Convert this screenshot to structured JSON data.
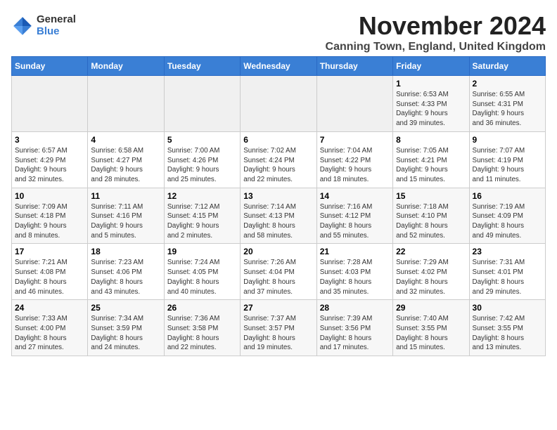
{
  "logo": {
    "general": "General",
    "blue": "Blue"
  },
  "title": "November 2024",
  "location": "Canning Town, England, United Kingdom",
  "headers": [
    "Sunday",
    "Monday",
    "Tuesday",
    "Wednesday",
    "Thursday",
    "Friday",
    "Saturday"
  ],
  "weeks": [
    [
      {
        "day": "",
        "info": ""
      },
      {
        "day": "",
        "info": ""
      },
      {
        "day": "",
        "info": ""
      },
      {
        "day": "",
        "info": ""
      },
      {
        "day": "",
        "info": ""
      },
      {
        "day": "1",
        "info": "Sunrise: 6:53 AM\nSunset: 4:33 PM\nDaylight: 9 hours\nand 39 minutes."
      },
      {
        "day": "2",
        "info": "Sunrise: 6:55 AM\nSunset: 4:31 PM\nDaylight: 9 hours\nand 36 minutes."
      }
    ],
    [
      {
        "day": "3",
        "info": "Sunrise: 6:57 AM\nSunset: 4:29 PM\nDaylight: 9 hours\nand 32 minutes."
      },
      {
        "day": "4",
        "info": "Sunrise: 6:58 AM\nSunset: 4:27 PM\nDaylight: 9 hours\nand 28 minutes."
      },
      {
        "day": "5",
        "info": "Sunrise: 7:00 AM\nSunset: 4:26 PM\nDaylight: 9 hours\nand 25 minutes."
      },
      {
        "day": "6",
        "info": "Sunrise: 7:02 AM\nSunset: 4:24 PM\nDaylight: 9 hours\nand 22 minutes."
      },
      {
        "day": "7",
        "info": "Sunrise: 7:04 AM\nSunset: 4:22 PM\nDaylight: 9 hours\nand 18 minutes."
      },
      {
        "day": "8",
        "info": "Sunrise: 7:05 AM\nSunset: 4:21 PM\nDaylight: 9 hours\nand 15 minutes."
      },
      {
        "day": "9",
        "info": "Sunrise: 7:07 AM\nSunset: 4:19 PM\nDaylight: 9 hours\nand 11 minutes."
      }
    ],
    [
      {
        "day": "10",
        "info": "Sunrise: 7:09 AM\nSunset: 4:18 PM\nDaylight: 9 hours\nand 8 minutes."
      },
      {
        "day": "11",
        "info": "Sunrise: 7:11 AM\nSunset: 4:16 PM\nDaylight: 9 hours\nand 5 minutes."
      },
      {
        "day": "12",
        "info": "Sunrise: 7:12 AM\nSunset: 4:15 PM\nDaylight: 9 hours\nand 2 minutes."
      },
      {
        "day": "13",
        "info": "Sunrise: 7:14 AM\nSunset: 4:13 PM\nDaylight: 8 hours\nand 58 minutes."
      },
      {
        "day": "14",
        "info": "Sunrise: 7:16 AM\nSunset: 4:12 PM\nDaylight: 8 hours\nand 55 minutes."
      },
      {
        "day": "15",
        "info": "Sunrise: 7:18 AM\nSunset: 4:10 PM\nDaylight: 8 hours\nand 52 minutes."
      },
      {
        "day": "16",
        "info": "Sunrise: 7:19 AM\nSunset: 4:09 PM\nDaylight: 8 hours\nand 49 minutes."
      }
    ],
    [
      {
        "day": "17",
        "info": "Sunrise: 7:21 AM\nSunset: 4:08 PM\nDaylight: 8 hours\nand 46 minutes."
      },
      {
        "day": "18",
        "info": "Sunrise: 7:23 AM\nSunset: 4:06 PM\nDaylight: 8 hours\nand 43 minutes."
      },
      {
        "day": "19",
        "info": "Sunrise: 7:24 AM\nSunset: 4:05 PM\nDaylight: 8 hours\nand 40 minutes."
      },
      {
        "day": "20",
        "info": "Sunrise: 7:26 AM\nSunset: 4:04 PM\nDaylight: 8 hours\nand 37 minutes."
      },
      {
        "day": "21",
        "info": "Sunrise: 7:28 AM\nSunset: 4:03 PM\nDaylight: 8 hours\nand 35 minutes."
      },
      {
        "day": "22",
        "info": "Sunrise: 7:29 AM\nSunset: 4:02 PM\nDaylight: 8 hours\nand 32 minutes."
      },
      {
        "day": "23",
        "info": "Sunrise: 7:31 AM\nSunset: 4:01 PM\nDaylight: 8 hours\nand 29 minutes."
      }
    ],
    [
      {
        "day": "24",
        "info": "Sunrise: 7:33 AM\nSunset: 4:00 PM\nDaylight: 8 hours\nand 27 minutes."
      },
      {
        "day": "25",
        "info": "Sunrise: 7:34 AM\nSunset: 3:59 PM\nDaylight: 8 hours\nand 24 minutes."
      },
      {
        "day": "26",
        "info": "Sunrise: 7:36 AM\nSunset: 3:58 PM\nDaylight: 8 hours\nand 22 minutes."
      },
      {
        "day": "27",
        "info": "Sunrise: 7:37 AM\nSunset: 3:57 PM\nDaylight: 8 hours\nand 19 minutes."
      },
      {
        "day": "28",
        "info": "Sunrise: 7:39 AM\nSunset: 3:56 PM\nDaylight: 8 hours\nand 17 minutes."
      },
      {
        "day": "29",
        "info": "Sunrise: 7:40 AM\nSunset: 3:55 PM\nDaylight: 8 hours\nand 15 minutes."
      },
      {
        "day": "30",
        "info": "Sunrise: 7:42 AM\nSunset: 3:55 PM\nDaylight: 8 hours\nand 13 minutes."
      }
    ]
  ]
}
